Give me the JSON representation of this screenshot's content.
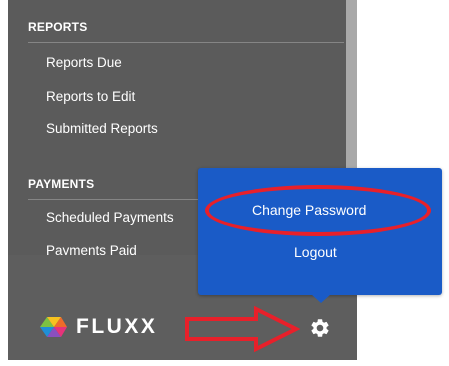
{
  "sections": {
    "reports": {
      "header": "REPORTS",
      "items": [
        "Reports Due",
        "Reports to Edit",
        "Submitted Reports"
      ]
    },
    "payments": {
      "header": "PAYMENTS",
      "items": [
        "Scheduled Payments",
        "Payments Paid"
      ]
    }
  },
  "logo": {
    "text": "FLUXX"
  },
  "user_menu": {
    "change_password_label": "Change Password",
    "logout_label": "Logout"
  },
  "colors": {
    "sidebar": "#5b5b5b",
    "popup": "#1a5bc7",
    "annotation": "#e8202a"
  },
  "icons": [
    "gear-icon",
    "fluxx-logo-icon",
    "annotation-arrow"
  ]
}
